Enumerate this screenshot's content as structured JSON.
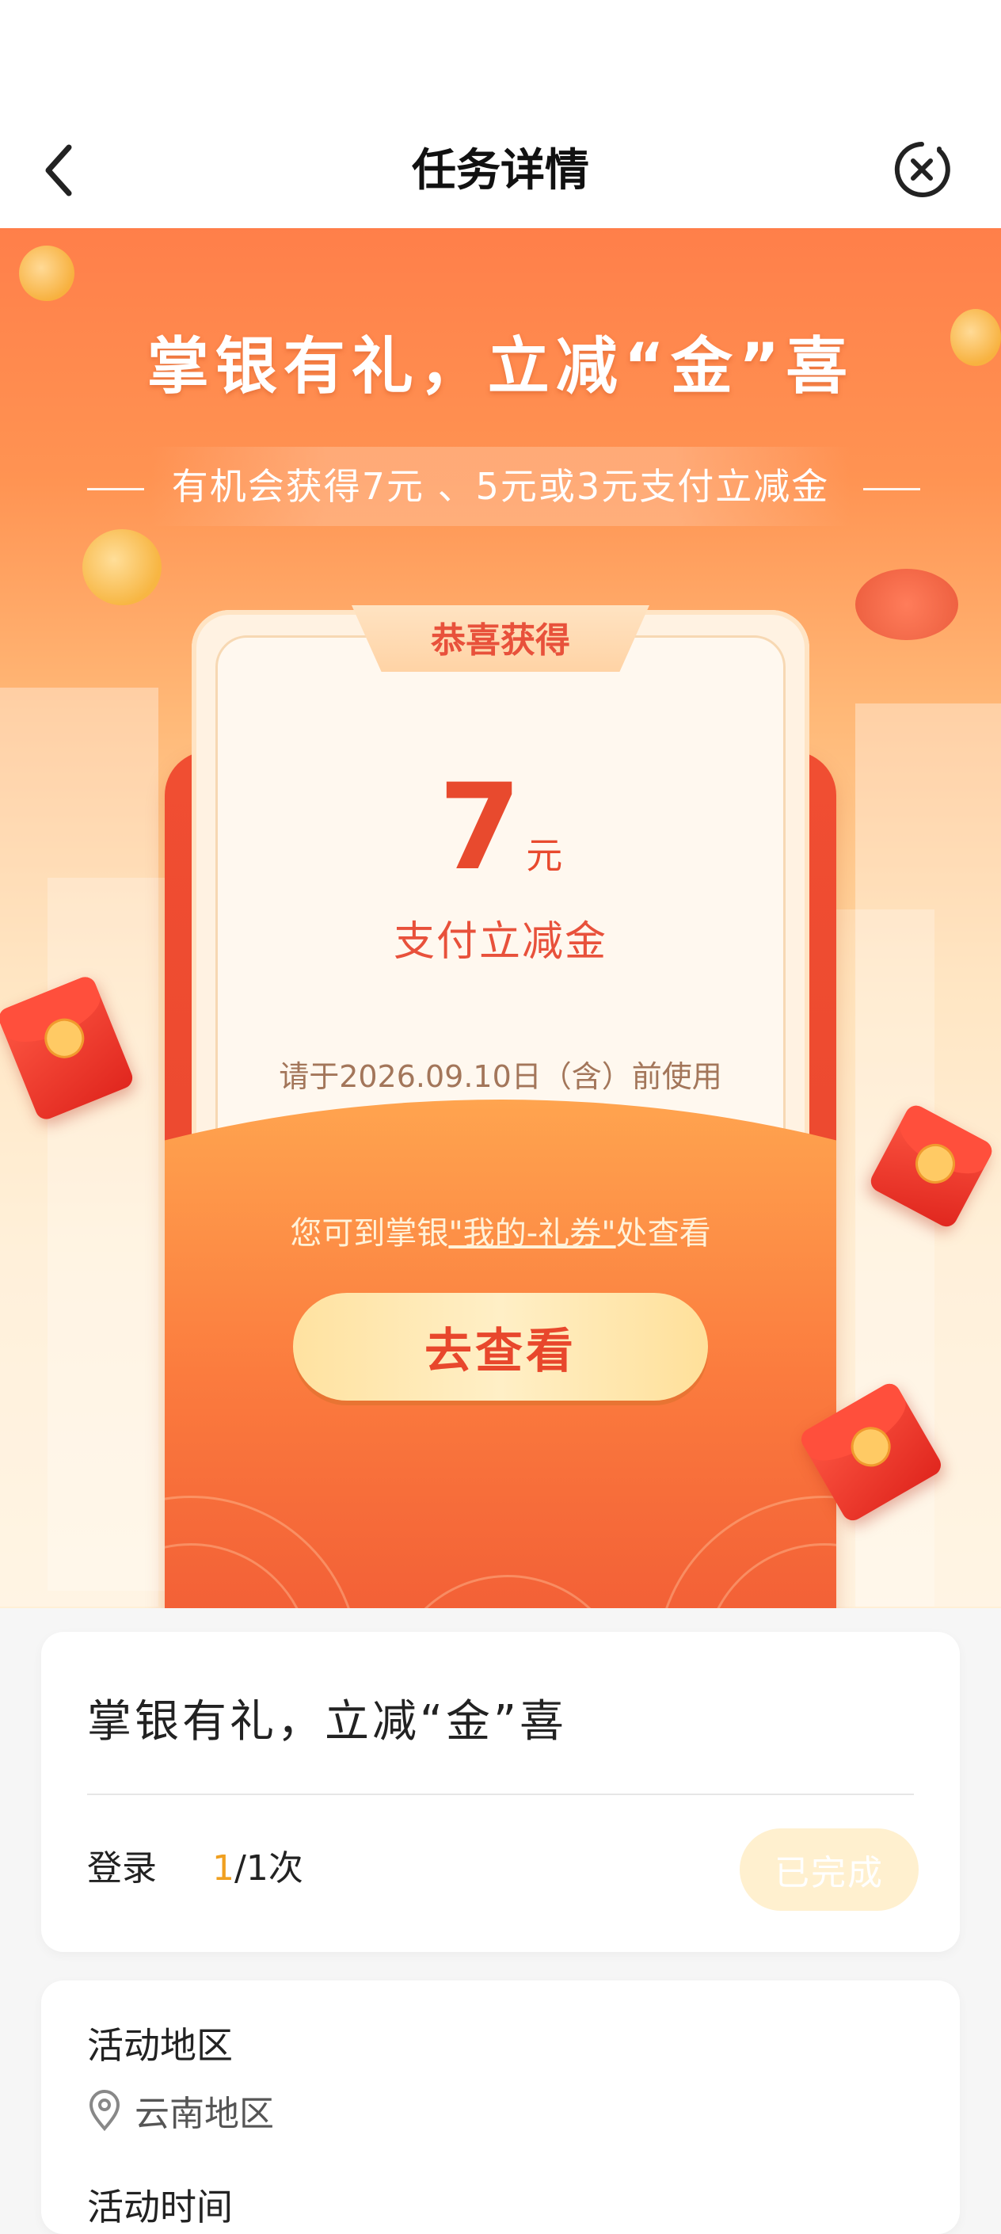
{
  "nav": {
    "title": "任务详情",
    "back_icon": "chevron-left-icon",
    "close_icon": "close-circle-icon"
  },
  "hero": {
    "title": "掌银有礼，立减“金”喜",
    "subtitle": "有机会获得7元 、5元或3元支付立减金",
    "card_tag": "恭喜获得",
    "amount_value": "7",
    "amount_unit": "元",
    "amount_label": "支付立减金",
    "expiry": "请于2026.09.10日（含）前使用",
    "hint_prefix": "您可到掌银",
    "hint_link": "\"我的-礼券\"",
    "hint_suffix": "处查看",
    "cta_label": "去查看"
  },
  "task_card": {
    "title": "掌银有礼，立减“金”喜",
    "task_label": "登录",
    "progress_done": "1",
    "progress_rest": "/1次",
    "status_badge": "已完成"
  },
  "details": {
    "region_title": "活动地区",
    "region_value": "云南地区",
    "region_icon": "location-pin-icon",
    "time_title": "活动时间"
  },
  "colors": {
    "accent_red": "#e84a2e",
    "progress_gold": "#f0a020",
    "badge_bg": "#fff0cf"
  }
}
